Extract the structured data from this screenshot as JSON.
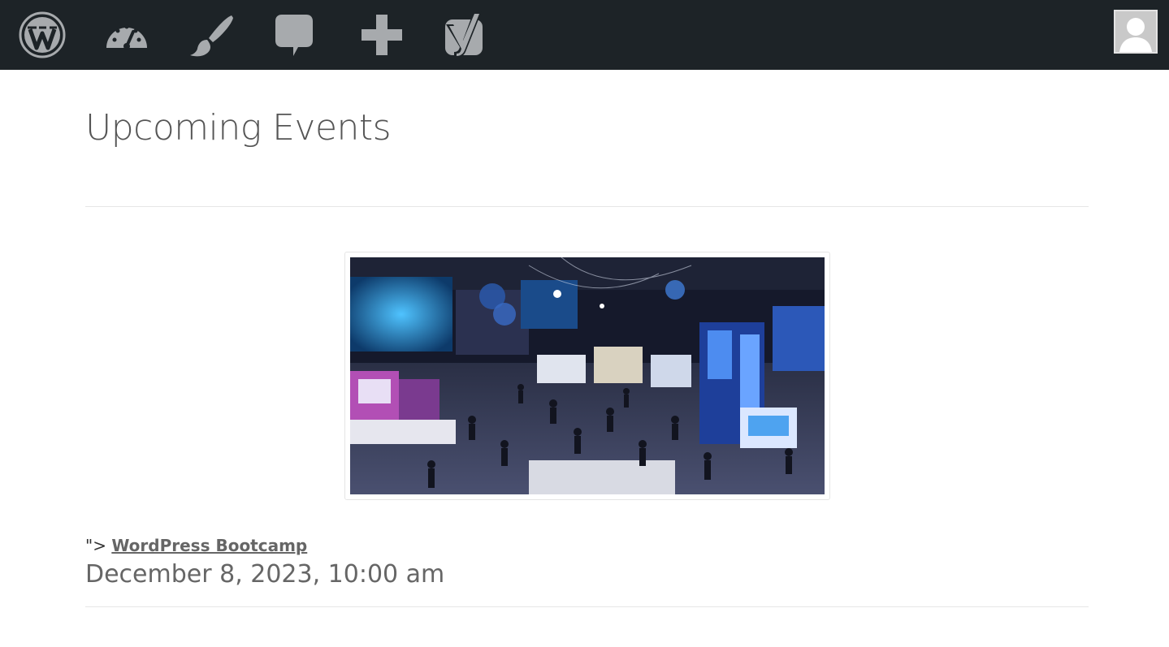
{
  "admin_bar": {
    "icons": [
      "wordpress-logo-icon",
      "dashboard-icon",
      "customize-brush-icon",
      "comments-icon",
      "new-content-plus-icon",
      "yoast-seo-icon"
    ],
    "avatar": "user-avatar-icon"
  },
  "page": {
    "title": "Upcoming Events"
  },
  "event": {
    "prefix": "\">",
    "title": "WordPress Bootcamp",
    "date": "December 8, 2023, 10:00 am",
    "image_subject": "expo-hall-photo"
  },
  "colors": {
    "admin_bar_bg": "#1d2327",
    "admin_icon": "#a7aaad",
    "title_text": "#555555",
    "meta_text": "#666666"
  }
}
